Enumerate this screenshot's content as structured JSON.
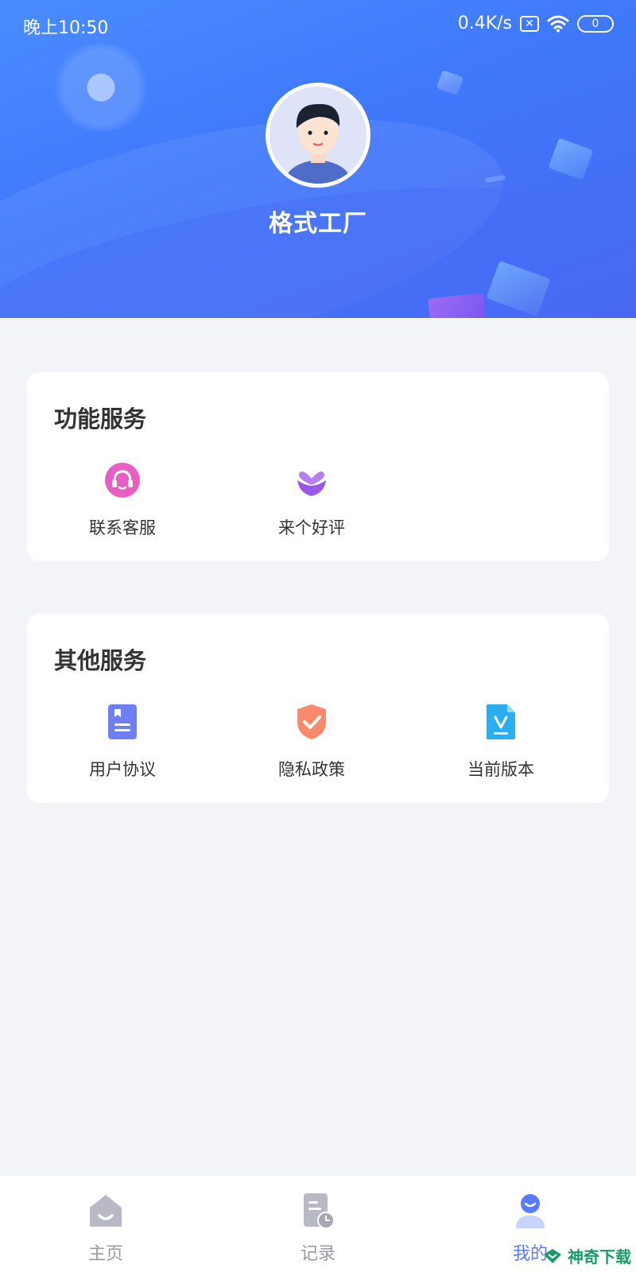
{
  "status_bar": {
    "time": "晚上10:50",
    "net_speed": "0.4K/s",
    "battery": "0"
  },
  "profile": {
    "username": "格式工厂"
  },
  "function_services": {
    "title": "功能服务",
    "items": [
      {
        "label": "联系客服",
        "icon": "customer-service-icon",
        "color": "#e95ec3"
      },
      {
        "label": "来个好评",
        "icon": "flower-heart-icon",
        "color": "#a866ee"
      }
    ]
  },
  "other_services": {
    "title": "其他服务",
    "items": [
      {
        "label": "用户协议",
        "icon": "document-icon",
        "color": "#6f7ef5"
      },
      {
        "label": "隐私政策",
        "icon": "shield-check-icon",
        "color": "#fb8a6c"
      },
      {
        "label": "当前版本",
        "icon": "version-file-icon",
        "color": "#2aaef0"
      }
    ]
  },
  "tabbar": {
    "items": [
      {
        "label": "主页",
        "icon": "home-icon",
        "active": false
      },
      {
        "label": "记录",
        "icon": "record-icon",
        "active": false
      },
      {
        "label": "我的",
        "icon": "profile-icon",
        "active": true
      }
    ]
  },
  "watermark": {
    "text": "神奇下载"
  },
  "colors": {
    "header_gradient_start": "#4a8cff",
    "header_gradient_end": "#4a67f2",
    "page_background": "#f2f4f8",
    "active_tab": "#5a7bff",
    "inactive_tab": "#9a9aa6"
  }
}
